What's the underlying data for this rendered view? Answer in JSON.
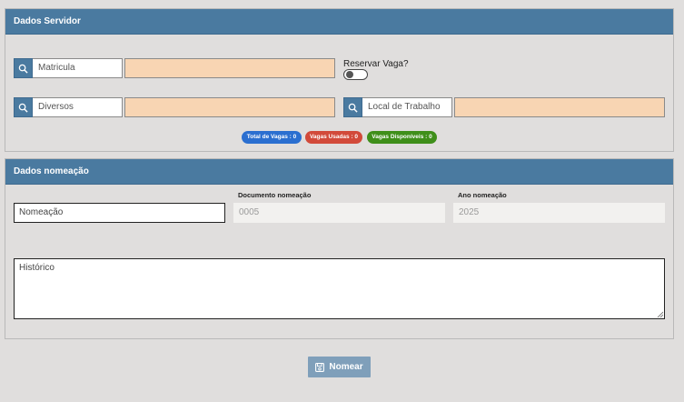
{
  "servidor_panel": {
    "title": "Dados Servidor",
    "matricula_label": "Matricula",
    "diversos_label": "Diversos",
    "local_trabalho_label": "Local de Trabalho",
    "reservar_vaga_label": "Reservar Vaga?",
    "badges": {
      "total": "Total de Vagas : 0",
      "usadas": "Vagas Usadas : 0",
      "disponiveis": "Vagas Disponíveis : 0"
    }
  },
  "nomeacao_panel": {
    "title": "Dados nomeação",
    "nomeacao_placeholder": "Nomeação",
    "documento_label": "Documento nomeação",
    "documento_value": "0005",
    "ano_label": "Ano nomeação",
    "ano_value": "2025",
    "historico_placeholder": "Histórico"
  },
  "actions": {
    "nomear_label": "Nomear"
  },
  "icons": {
    "search": "search-icon",
    "save": "save-icon"
  },
  "colors": {
    "header": "#4a7aa0",
    "peach": "#f8d5b3",
    "badge_blue": "#2b6fd0",
    "badge_red": "#d24a3a",
    "badge_green": "#3f8f1a",
    "button": "#7f9fba"
  }
}
